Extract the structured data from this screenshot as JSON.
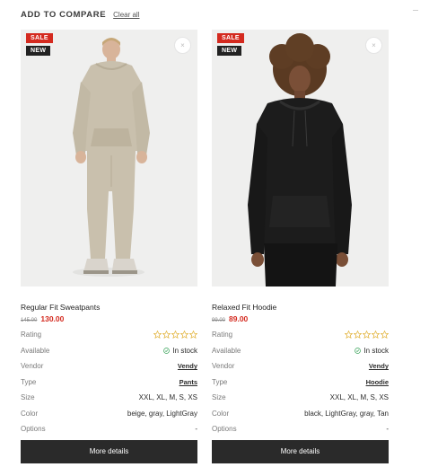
{
  "header": {
    "title": "ADD TO COMPARE",
    "clear_all": "Clear all"
  },
  "colors": {
    "sale_badge": "#d42a1f",
    "new_badge": "#222222",
    "sale_price": "#d42a1f",
    "button_bg": "#2a2a2a",
    "in_stock": "#3aa35a",
    "star_outline": "#e2b33a"
  },
  "products": [
    {
      "badges": {
        "sale": "SALE",
        "new": "NEW"
      },
      "name": "Regular Fit Sweatpants",
      "price_old": "145.00",
      "price_new": "130.00",
      "rating": 0,
      "remove_icon": "close-icon",
      "attributes": {
        "rating_label": "Rating",
        "available_label": "Available",
        "available_value": "In stock",
        "vendor_label": "Vendor",
        "vendor_value": "Vendy",
        "type_label": "Type",
        "type_value": "Pants",
        "size_label": "Size",
        "size_value": "XXL, XL, M, S, XS",
        "color_label": "Color",
        "color_value": "beige, gray, LightGray",
        "options_label": "Options",
        "options_value": "-"
      },
      "button_label": "More details"
    },
    {
      "badges": {
        "sale": "SALE",
        "new": "NEW"
      },
      "name": "Relaxed Fit Hoodie",
      "price_old": "99.00",
      "price_new": "89.00",
      "rating": 0,
      "remove_icon": "close-icon",
      "attributes": {
        "rating_label": "Rating",
        "available_label": "Available",
        "available_value": "In stock",
        "vendor_label": "Vendor",
        "vendor_value": "Vendy",
        "type_label": "Type",
        "type_value": "Hoodie",
        "size_label": "Size",
        "size_value": "XXL, XL, M, S, XS",
        "color_label": "Color",
        "color_value": "black, LightGray, gray, Tan",
        "options_label": "Options",
        "options_value": "-"
      },
      "button_label": "More details"
    }
  ]
}
